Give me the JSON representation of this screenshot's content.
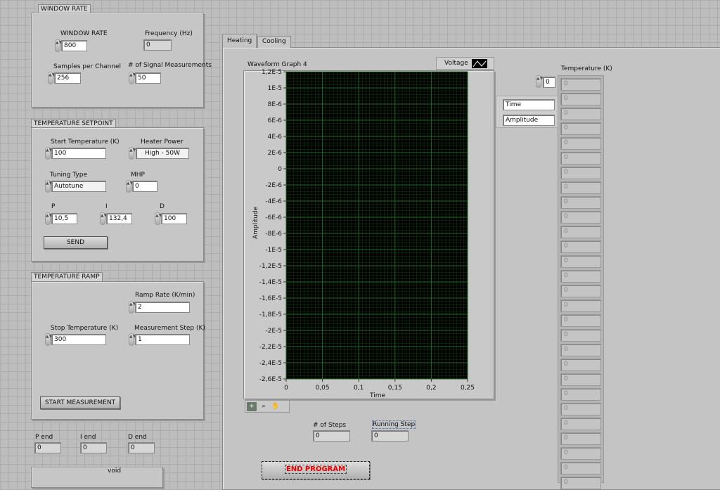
{
  "window_rate": {
    "caption": "WINDOW RATE",
    "window_rate_label": "WINDOW RATE",
    "window_rate_value": "800",
    "frequency_label": "Frequency (Hz)",
    "frequency_value": "0",
    "samples_label": "Samples per Channel",
    "samples_value": "256",
    "signal_label": "# of Signal Measurements",
    "signal_value": "50"
  },
  "setpoint": {
    "caption": "TEMPERATURE SETPOINT",
    "start_temp_label": "Start Temperature (K)",
    "start_temp_value": "100",
    "heater_label": "Heater Power",
    "heater_value": "High - 50W",
    "tuning_label": "Tuning Type",
    "tuning_value": "Autotune",
    "mhp_label": "MHP",
    "mhp_value": "0",
    "p_label": "P",
    "p_value": "10,5",
    "i_label": "I",
    "i_value": "132,4",
    "d_label": "D",
    "d_value": "100",
    "send": "SEND"
  },
  "ramp": {
    "caption": "TEMPERATURE RAMP",
    "rate_label": "Ramp Rate (K/min)",
    "rate_value": "2",
    "stop_label": "Stop Temperature (K)",
    "stop_value": "300",
    "step_label": "Measurement Step (K)",
    "step_value": "1",
    "start": "START MEASUREMENT"
  },
  "ends": {
    "p_label": "P end",
    "p_value": "0",
    "i_label": "I end",
    "i_value": "0",
    "d_label": "D end",
    "d_value": "0",
    "void": "void"
  },
  "tabs": [
    {
      "label": "Heating",
      "active": true
    },
    {
      "label": "Cooling",
      "active": false
    }
  ],
  "graph": {
    "title": "Waveform Graph 4",
    "legend": "Voltage",
    "xlabel": "Time",
    "ylabel": "Amplitude",
    "cursor_time": "Time",
    "cursor_amplitude": "Amplitude",
    "plot_bg": "#000000",
    "grid_color": "#1e6b1e"
  },
  "chart_data": {
    "type": "line",
    "title": "Waveform Graph 4",
    "xlabel": "Time",
    "ylabel": "Amplitude",
    "xlim": [
      0,
      0.25
    ],
    "ylim": [
      -2.6e-05,
      1.2e-05
    ],
    "grid": true,
    "series": [
      {
        "name": "Voltage",
        "x": [],
        "y": []
      }
    ],
    "xticks": [
      "0",
      "0,05",
      "0,1",
      "0,15",
      "0,2",
      "0,25"
    ],
    "yticks": [
      "1,2E-5",
      "1E-5",
      "8E-6",
      "6E-6",
      "4E-6",
      "2E-6",
      "0",
      "-2E-6",
      "-4E-6",
      "-6E-6",
      "-8E-6",
      "-1E-5",
      "-1,2E-5",
      "-1,4E-5",
      "-1,6E-5",
      "-1,8E-5",
      "-2E-5",
      "-2,2E-5",
      "-2,4E-5",
      "-2,6E-5"
    ]
  },
  "steps": {
    "steps_label": "# of Steps",
    "steps_value": "0",
    "running_label": "Running Step",
    "running_value": "0"
  },
  "end_program": "END PROGRAM",
  "temperature_array": {
    "label": "Temperature (K)",
    "index": "0",
    "values": [
      "0",
      "0",
      "0",
      "0",
      "0",
      "0",
      "0",
      "0",
      "0",
      "0",
      "0",
      "0",
      "0",
      "0",
      "0",
      "0",
      "0",
      "0",
      "0",
      "0",
      "0",
      "0",
      "0",
      "0",
      "0",
      "0",
      "0",
      "0"
    ]
  }
}
